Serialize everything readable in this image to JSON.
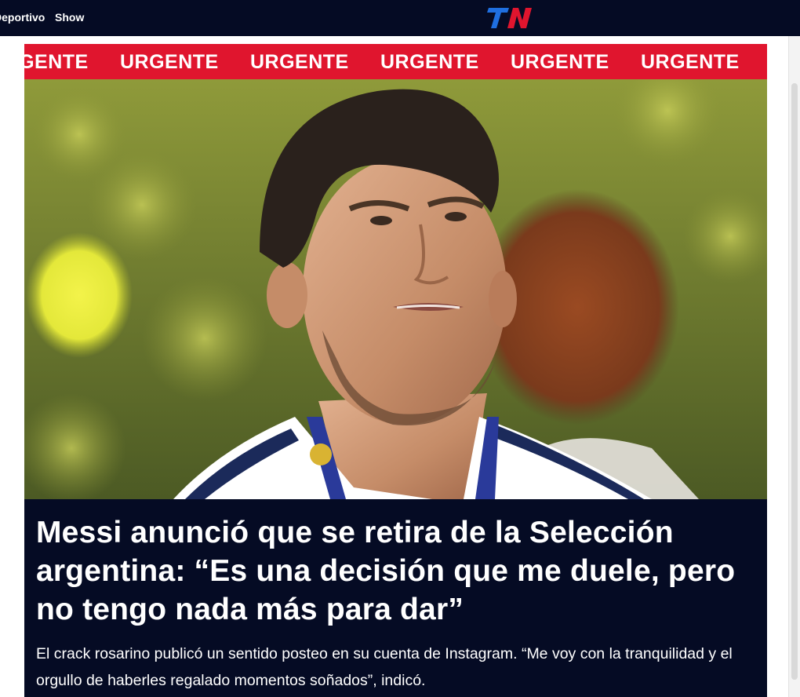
{
  "nav": {
    "items": [
      {
        "label": "Deportivo"
      },
      {
        "label": "Show"
      }
    ],
    "logo_text": "TN",
    "logo_colors": {
      "blue": "#1f6fe0",
      "red": "#e0152e"
    }
  },
  "ticker": {
    "label": "URGENTE",
    "repeat_count": 7,
    "background": "#e0152e"
  },
  "hero": {
    "description_icon": "hero-photo"
  },
  "article": {
    "headline": "Messi anunció que se retira de la Selección argentina: “Es una decisión que me duele, pero no tengo nada más para dar”",
    "lead": "El crack rosarino publicó un sentido posteo en su cuenta de Instagram. “Me voy con la tranquilidad y el orgullo de haberles regalado momentos soñados”, indicó."
  },
  "colors": {
    "navy": "#050b24",
    "accent_red": "#e0152e",
    "text_white": "#ffffff"
  }
}
